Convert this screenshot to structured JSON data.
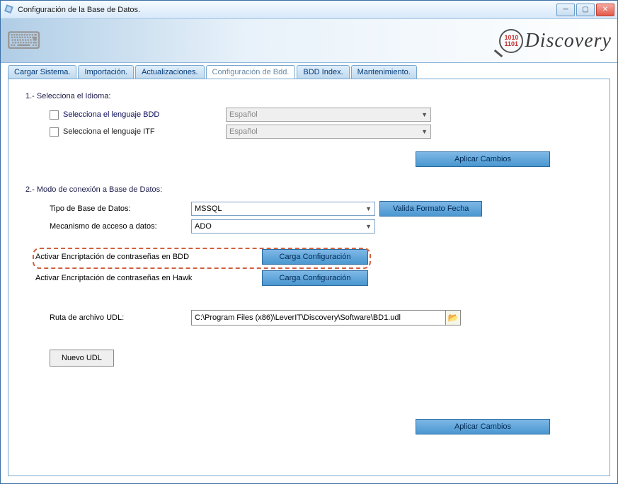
{
  "window": {
    "title": "Configuración de la Base de Datos."
  },
  "logo": {
    "bits": "1010\n1101",
    "text": "Discovery"
  },
  "tabs": [
    {
      "label": "Cargar Sistema."
    },
    {
      "label": "Importación."
    },
    {
      "label": "Actualizaciones."
    },
    {
      "label": "Configuración de Bdd."
    },
    {
      "label": "BDD Index."
    },
    {
      "label": "Mantenimiento."
    }
  ],
  "sec1": {
    "heading": "1.- Selecciona el Idioma:",
    "bdd_label": "Selecciona el lenguaje BDD",
    "bdd_value": "Español",
    "itf_label": "Selecciona el lenguaje ITF",
    "itf_value": "Español",
    "apply": "Aplicar Cambios"
  },
  "sec2": {
    "heading": "2.- Modo de conexión a Base de Datos:",
    "dbtype_label": "Tipo de Base de Datos:",
    "dbtype_value": "MSSQL",
    "valida": "Valida Formato Fecha",
    "mech_label": "Mecanismo de acceso a datos:",
    "mech_value": "ADO",
    "enc_bdd_label": "Activar Encriptación de contraseñas en BDD",
    "enc_bdd_btn": "Carga Configuración",
    "enc_hawk_label": "Activar Encriptación de contraseñas en Hawk",
    "enc_hawk_btn": "Carga Configuración",
    "udl_label": "Ruta de archivo UDL:",
    "udl_path": "C:\\Program Files (x86)\\LeverIT\\Discovery\\Software\\BD1.udl",
    "nuevo_udl": "Nuevo UDL",
    "apply": "Aplicar Cambios"
  }
}
